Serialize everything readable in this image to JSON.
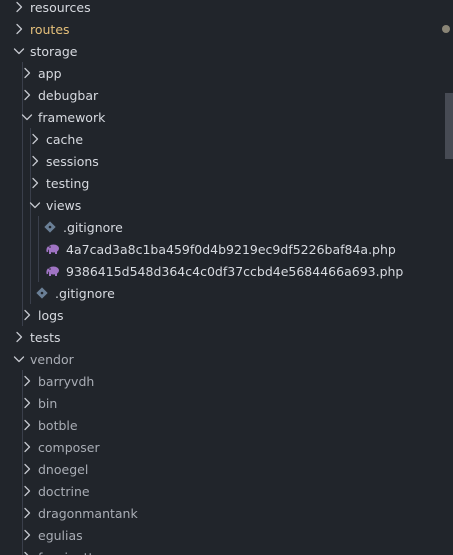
{
  "tree": [
    {
      "label": "resources",
      "depth": 0,
      "kind": "folder",
      "expanded": false
    },
    {
      "label": "routes",
      "depth": 0,
      "kind": "folder",
      "expanded": false,
      "modified": true
    },
    {
      "label": "storage",
      "depth": 0,
      "kind": "folder",
      "expanded": true
    },
    {
      "label": "app",
      "depth": 1,
      "kind": "folder",
      "expanded": false
    },
    {
      "label": "debugbar",
      "depth": 1,
      "kind": "folder",
      "expanded": false
    },
    {
      "label": "framework",
      "depth": 1,
      "kind": "folder",
      "expanded": true
    },
    {
      "label": "cache",
      "depth": 2,
      "kind": "folder",
      "expanded": false
    },
    {
      "label": "sessions",
      "depth": 2,
      "kind": "folder",
      "expanded": false
    },
    {
      "label": "testing",
      "depth": 2,
      "kind": "folder",
      "expanded": false
    },
    {
      "label": "views",
      "depth": 2,
      "kind": "folder",
      "expanded": true
    },
    {
      "label": ".gitignore",
      "depth": 3,
      "kind": "gitignore"
    },
    {
      "label": "4a7cad3a8c1ba459f0d4b9219ec9df5226baf84a.php",
      "depth": 3,
      "kind": "php"
    },
    {
      "label": "9386415d548d364c4c0df37ccbd4e5684466a693.php",
      "depth": 3,
      "kind": "php"
    },
    {
      "label": ".gitignore",
      "depth": 2,
      "kind": "gitignore"
    },
    {
      "label": "logs",
      "depth": 1,
      "kind": "folder",
      "expanded": false
    },
    {
      "label": "tests",
      "depth": 0,
      "kind": "folder",
      "expanded": false
    },
    {
      "label": "vendor",
      "depth": 0,
      "kind": "folder",
      "expanded": true,
      "dim": true
    },
    {
      "label": "barryvdh",
      "depth": 1,
      "kind": "folder",
      "expanded": false,
      "dim": true
    },
    {
      "label": "bin",
      "depth": 1,
      "kind": "folder",
      "expanded": false,
      "dim": true
    },
    {
      "label": "botble",
      "depth": 1,
      "kind": "folder",
      "expanded": false,
      "dim": true
    },
    {
      "label": "composer",
      "depth": 1,
      "kind": "folder",
      "expanded": false,
      "dim": true
    },
    {
      "label": "dnoegel",
      "depth": 1,
      "kind": "folder",
      "expanded": false,
      "dim": true
    },
    {
      "label": "doctrine",
      "depth": 1,
      "kind": "folder",
      "expanded": false,
      "dim": true
    },
    {
      "label": "dragonmantank",
      "depth": 1,
      "kind": "folder",
      "expanded": false,
      "dim": true
    },
    {
      "label": "egulias",
      "depth": 1,
      "kind": "folder",
      "expanded": false,
      "dim": true
    },
    {
      "label": "fzaninotto",
      "depth": 1,
      "kind": "folder",
      "expanded": false,
      "dim": true
    }
  ],
  "colors": {
    "background": "#21252b",
    "text": "#d7dae0",
    "dim_text": "#a9adb5",
    "modified_text": "#e5c07b",
    "php_icon": "#a074c4",
    "gitignore_icon": "#6a7f96"
  },
  "icons": {
    "collapsed": "chevron-right-icon",
    "expanded": "chevron-down-icon",
    "php": "php-elephant-icon",
    "gitignore": "git-file-icon"
  }
}
